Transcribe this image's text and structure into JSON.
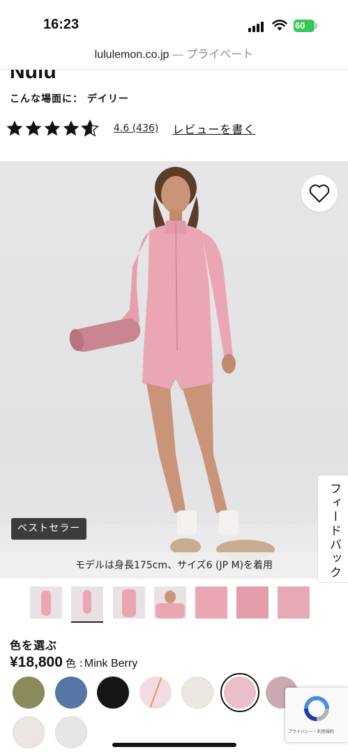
{
  "status_bar": {
    "time": "16:23",
    "battery": "60",
    "icons": [
      "signal-icon",
      "wifi-icon",
      "battery-icon"
    ]
  },
  "url_bar": {
    "domain": "lululemon.co.jp",
    "separator": " — ",
    "mode": "プライベート"
  },
  "product": {
    "name": "Nulu",
    "activity_label": "こんな場面に：",
    "activity_value": "デイリー",
    "rating_value": "4.6",
    "review_count": "(436)",
    "rating_stars": 4.6,
    "write_review": "レビューを書く"
  },
  "hero": {
    "badge": "ベストセラー",
    "caption": "モデルは身長175cm、サイズ6 (JP M)を着用",
    "wishlist_icon": "heart-icon"
  },
  "feedback": {
    "label": "フィードバック"
  },
  "thumbnails": {
    "count": 7,
    "active_index": 1
  },
  "color_selector": {
    "title": "色を選ぶ",
    "price": "¥18,800",
    "color_label": "色 :",
    "color_name": "Mink Berry",
    "swatches": [
      {
        "name": "olive",
        "color": "#8a8a5a"
      },
      {
        "name": "blue",
        "color": "#5676a6"
      },
      {
        "name": "black",
        "color": "#161616"
      },
      {
        "name": "pink-pattern",
        "color": "#f5dbe3"
      },
      {
        "name": "ivory",
        "color": "#ece8e1"
      },
      {
        "name": "mink-berry",
        "color": "#e9bfc9",
        "selected": true
      },
      {
        "name": "mauve",
        "color": "#c9aab0"
      },
      {
        "name": "light-bone",
        "color": "#ebe6df"
      },
      {
        "name": "heather-grey",
        "color": "#e6e6e8"
      }
    ]
  },
  "recaptcha": {
    "text": "プライバシー・利用規約"
  },
  "colors": {
    "accent_green": "#34c759",
    "badge_bg": "#3c3c3c",
    "product_pink": "#eaa7b3"
  }
}
